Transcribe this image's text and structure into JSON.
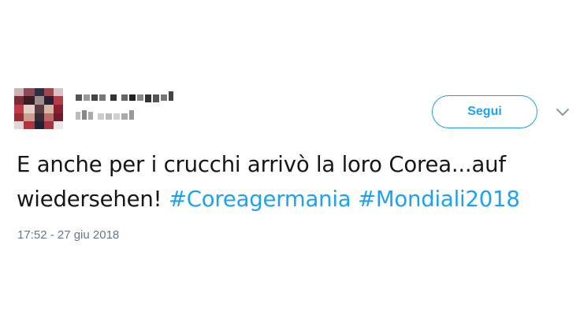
{
  "tweet": {
    "follow_label": "Segui",
    "text": "E anche per i crucchi arrivò la loro Corea...auf wiedersehen!",
    "hashtags": [
      "#Coreagermania",
      "#Mondiali2018"
    ],
    "timestamp": "17:52 - 27 giu 2018",
    "caret_icon": "chevron-down-icon"
  },
  "colors": {
    "accent": "#1da1f2",
    "text": "#14171a",
    "muted": "#657786"
  }
}
